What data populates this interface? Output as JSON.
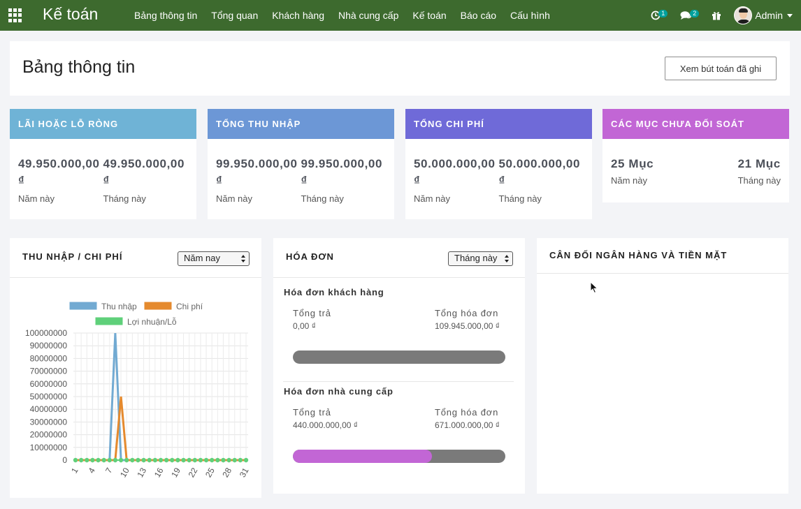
{
  "topbar": {
    "app_title": "Kế toán",
    "menu": [
      "Bảng thông tin",
      "Tổng quan",
      "Khách hàng",
      "Nhà cung cấp",
      "Kế toán",
      "Báo cáo",
      "Cấu hình"
    ],
    "activity_count": "1",
    "messages_count": "2",
    "user_name": "Admin",
    "icons": [
      "apps-grid-icon",
      "clock-icon",
      "chat-icon",
      "gift-icon",
      "user-avatar"
    ]
  },
  "header": {
    "title": "Bảng thông tin",
    "posted_entries_button": "Xem bút toán đã ghi"
  },
  "kpis": [
    {
      "title": "LÃI HOẶC LỖ RÒNG",
      "color": "#6fb3d6",
      "year_value": "49.950.000,00 ₫",
      "year_label": "Năm này",
      "month_value": "49.950.000,00 ₫",
      "month_label": "Tháng này"
    },
    {
      "title": "TỔNG THU NHẬP",
      "color": "#6c97d6",
      "year_value": "99.950.000,00 ₫",
      "year_label": "Năm này",
      "month_value": "99.950.000,00 ₫",
      "month_label": "Tháng này"
    },
    {
      "title": "TỔNG CHI PHÍ",
      "color": "#6f6ad8",
      "year_value": "50.000.000,00 ₫",
      "year_label": "Năm này",
      "month_value": "50.000.000,00 ₫",
      "month_label": "Tháng này"
    },
    {
      "title": "CÁC MỤC CHƯA ĐỐI SOÁT",
      "color": "#c266d5",
      "year_value": "25 Mục",
      "year_label": "Năm này",
      "month_value": "21 Mục",
      "month_label": "Tháng này"
    }
  ],
  "income_expense": {
    "title": "THU NHẬP / CHI PHÍ",
    "period": "Năm nay"
  },
  "invoices": {
    "title": "HÓA ĐƠN",
    "period": "Tháng này",
    "customer": {
      "title": "Hóa đơn khách hàng",
      "paid_label": "Tổng trả",
      "paid_value": "0,00 ₫",
      "total_label": "Tổng hóa đơn",
      "total_value": "109.945.000,00 ₫",
      "progress": 0.0,
      "fill_color": "#7a7a7a"
    },
    "vendor": {
      "title": "Hóa đơn nhà cung cấp",
      "paid_label": "Tổng trả",
      "paid_value": "440.000.000,00 ₫",
      "total_label": "Tổng hóa đơn",
      "total_value": "671.000.000,00 ₫",
      "progress": 0.655,
      "fill_color": "#c266d5"
    }
  },
  "bank_cash": {
    "title": "CÂN ĐỐI NGÂN HÀNG VÀ TIỀN MẶT"
  },
  "chart_data": {
    "type": "line",
    "title": "",
    "xlabel": "",
    "ylabel": "",
    "ylim": [
      0,
      100000000
    ],
    "yticks": [
      "0",
      "10000000",
      "20000000",
      "30000000",
      "40000000",
      "50000000",
      "60000000",
      "70000000",
      "80000000",
      "90000000",
      "100000000"
    ],
    "x": [
      1,
      2,
      3,
      4,
      5,
      6,
      7,
      8,
      9,
      10,
      11,
      12,
      13,
      14,
      15,
      16,
      17,
      18,
      19,
      20,
      21,
      22,
      23,
      24,
      25,
      26,
      27,
      28,
      29,
      30,
      31
    ],
    "xtick_labels": [
      "1",
      "4",
      "7",
      "10",
      "13",
      "16",
      "19",
      "22",
      "25",
      "28",
      "31"
    ],
    "legend_position": "top",
    "series": [
      {
        "name": "Thu nhập",
        "color": "#72aad2",
        "values": [
          0,
          0,
          0,
          0,
          0,
          0,
          0,
          99950000,
          0,
          0,
          0,
          0,
          0,
          0,
          0,
          0,
          0,
          0,
          0,
          0,
          0,
          0,
          0,
          0,
          0,
          0,
          0,
          0,
          0,
          0,
          0
        ]
      },
      {
        "name": "Chi phí",
        "color": "#e58a2e",
        "values": [
          0,
          0,
          0,
          0,
          0,
          0,
          0,
          0,
          50000000,
          0,
          0,
          0,
          0,
          0,
          0,
          0,
          0,
          0,
          0,
          0,
          0,
          0,
          0,
          0,
          0,
          0,
          0,
          0,
          0,
          0,
          0
        ]
      },
      {
        "name": "Lợi nhuận/Lỗ",
        "color": "#5fd07a",
        "values": [
          0,
          0,
          0,
          0,
          0,
          0,
          0,
          0,
          0,
          0,
          0,
          0,
          0,
          0,
          0,
          0,
          0,
          0,
          0,
          0,
          0,
          0,
          0,
          0,
          0,
          0,
          0,
          0,
          0,
          0,
          0
        ]
      }
    ]
  }
}
